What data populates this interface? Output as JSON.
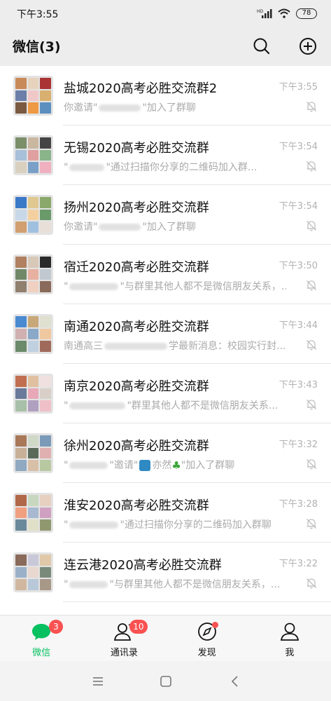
{
  "status_bar": {
    "time": "下午3:55",
    "network": "HD",
    "battery": "78"
  },
  "header": {
    "title": "微信(3)",
    "search_icon": "search-icon",
    "add_icon": "plus-circle-icon"
  },
  "chats": [
    {
      "name": "盐城2020高考必胜交流群2",
      "time": "下午3:55",
      "preview_prefix": "你邀请\"",
      "preview_suffix": "\"加入了群聊"
    },
    {
      "name": "无锡2020高考必胜交流群",
      "time": "下午3:54",
      "preview_prefix": "\"",
      "preview_suffix": "\"通过扫描你分享的二维码加入群..."
    },
    {
      "name": "扬州2020高考必胜交流群",
      "time": "下午3:54",
      "preview_prefix": "你邀请\"",
      "preview_suffix": "\"加入了群聊"
    },
    {
      "name": "宿迁2020高考必胜交流群",
      "time": "下午3:50",
      "preview_prefix": "\"",
      "preview_suffix": "\"与群里其他人都不是微信朋友关系，..."
    },
    {
      "name": "南通2020高考必胜交流群",
      "time": "下午3:44",
      "preview_prefix": "南通高三",
      "preview_suffix": "学最新消息：校园实行封..."
    },
    {
      "name": "南京2020高考必胜交流群",
      "time": "下午3:43",
      "preview_prefix": "\"",
      "preview_suffix": "\"群里其他人都不是微信朋友关系..."
    },
    {
      "name": "徐州2020高考必胜交流群",
      "time": "下午3:32",
      "preview_prefix": "\"",
      "preview_suffix": "\"邀请\"",
      "preview_name": "亦然",
      "preview_end": "\"加入了群聊"
    },
    {
      "name": "淮安2020高考必胜交流群",
      "time": "下午3:28",
      "preview_prefix": "\"",
      "preview_suffix": "\"通过扫描你分享的二维码加入群聊"
    },
    {
      "name": "连云港2020高考必胜交流群",
      "time": "下午3:22",
      "preview_prefix": "\"",
      "preview_suffix": "\"与群里其他人都不是微信朋友关系，..."
    }
  ],
  "tabs": [
    {
      "label": "微信",
      "icon": "chat-bubble-icon",
      "badge": "3",
      "active": true
    },
    {
      "label": "通讯录",
      "icon": "contacts-icon",
      "badge": "10"
    },
    {
      "label": "发现",
      "icon": "compass-icon",
      "dot": true
    },
    {
      "label": "我",
      "icon": "person-icon"
    }
  ],
  "nav": {
    "menu": "menu-icon",
    "home": "home-icon",
    "back": "back-icon"
  },
  "colors": {
    "accent": "#07c160",
    "badge": "#fa5151",
    "muted": "#b2b2b2"
  }
}
